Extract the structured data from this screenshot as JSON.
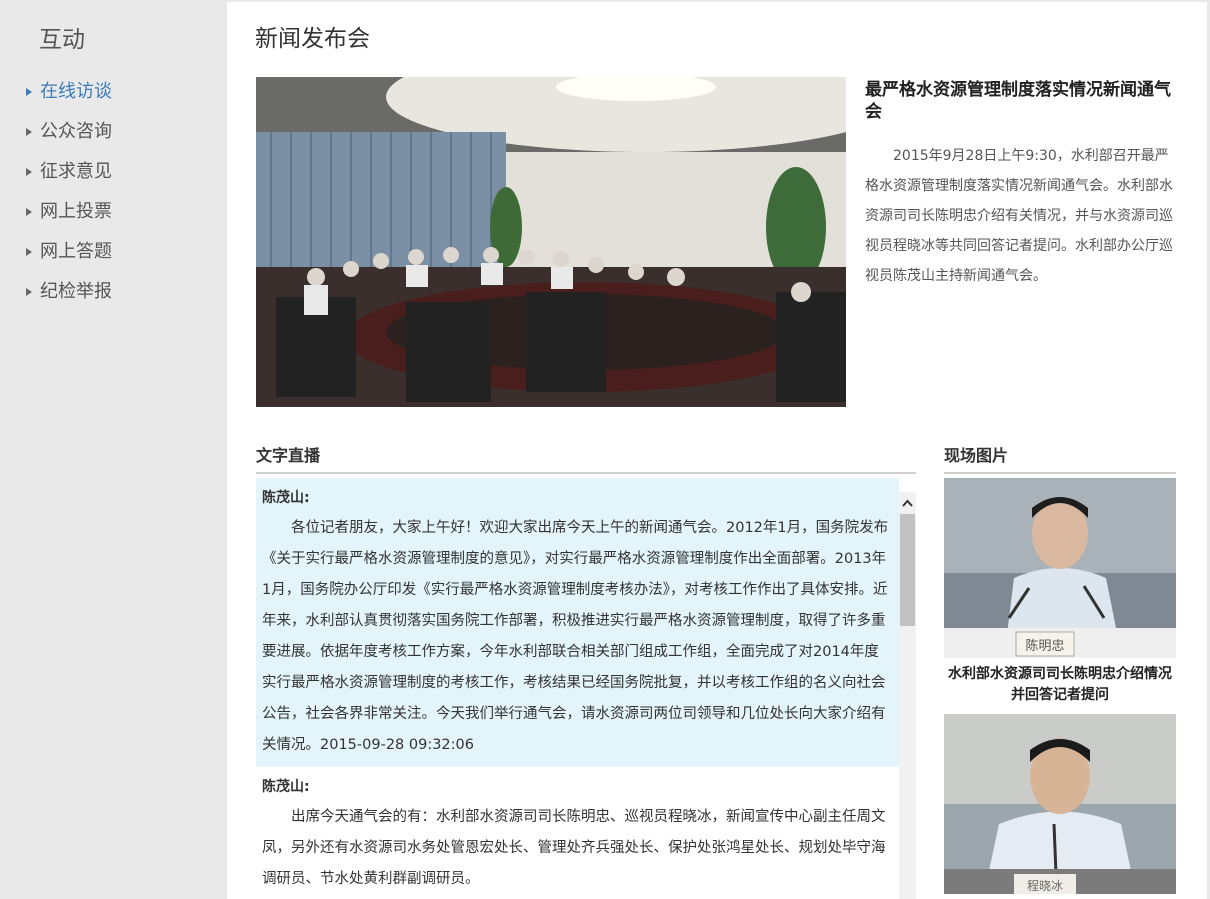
{
  "sidebar": {
    "title": "互动",
    "items": [
      {
        "label": "在线访谈",
        "active": true
      },
      {
        "label": "公众咨询"
      },
      {
        "label": "征求意见"
      },
      {
        "label": "网上投票"
      },
      {
        "label": "网上答题"
      },
      {
        "label": "纪检举报"
      }
    ]
  },
  "page": {
    "title": "新闻发布会"
  },
  "hero": {
    "title": "最严格水资源管理制度落实情况新闻通气会",
    "description": "2015年9月28日上午9:30，水利部召开最严格水资源管理制度落实情况新闻通气会。水利部水资源司司长陈明忠介绍有关情况，并与水资源司巡视员程晓冰等共同回答记者提问。水利部办公厅巡视员陈茂山主持新闻通气会。"
  },
  "sections": {
    "text_live": "文字直播",
    "photos": "现场图片"
  },
  "messages": [
    {
      "speaker": "陈茂山:",
      "text": "各位记者朋友，大家上午好！欢迎大家出席今天上午的新闻通气会。2012年1月，国务院发布《关于实行最严格水资源管理制度的意见》，对实行最严格水资源管理制度作出全面部署。2013年1月，国务院办公厅印发《实行最严格水资源管理制度考核办法》，对考核工作作出了具体安排。近年来，水利部认真贯彻落实国务院工作部署，积极推进实行最严格水资源管理制度，取得了许多重要进展。依据年度考核工作方案，今年水利部联合相关部门组成工作组，全面完成了对2014年度实行最严格水资源管理制度的考核工作，考核结果已经国务院批复，并以考核工作组的名义向社会公告，社会各界非常关注。今天我们举行通气会，请水资源司两位司领导和几位处长向大家介绍有关情况。2015-09-28 09:32:06"
    },
    {
      "speaker": "陈茂山:",
      "text": "出席今天通气会的有：水利部水资源司司长陈明忠、巡视员程晓冰，新闻宣传中心副主任周文凤，另外还有水资源司水务处管恩宏处长、管理处齐兵强处长、保护处张鸿星处长、规划处毕守海调研员、节水处黄利群副调研员。"
    }
  ],
  "photos": [
    {
      "caption": "水利部水资源司司长陈明忠介绍情况并回答记者提问",
      "nameplate": "陈明忠"
    },
    {
      "caption": "",
      "nameplate": "程晓冰"
    }
  ],
  "icons": {
    "sidebar_bullet": "triangle-right-icon",
    "scroll_up": "chevron-up-icon"
  },
  "colors": {
    "active_link": "#3a7bb8",
    "highlight_bg": "#e3f5fb",
    "sidebar_bg": "#e9e9e9"
  }
}
